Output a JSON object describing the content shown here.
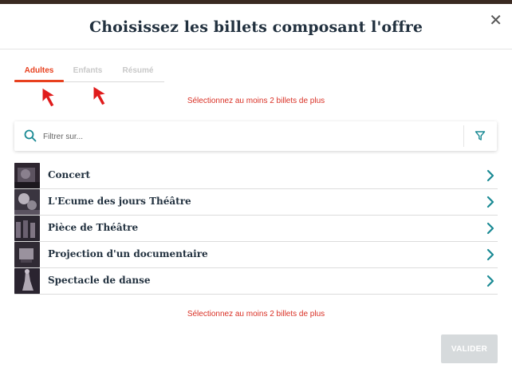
{
  "modal": {
    "title": "Choisissez les billets composant l'offre",
    "close_symbol": "✕"
  },
  "tabs": [
    {
      "label": "Adultes",
      "active": true
    },
    {
      "label": "Enfants",
      "active": false
    },
    {
      "label": "Résumé",
      "active": false
    }
  ],
  "warning_top": "Sélectionnez au moins 2 billets de plus",
  "warning_bottom": "Sélectionnez au moins 2 billets de plus",
  "search": {
    "placeholder": "Filtrer sur...",
    "icon": "search-icon",
    "filter_icon": "filter-icon"
  },
  "tickets": [
    {
      "label": "Concert"
    },
    {
      "label": "L'Ecume des jours Théâtre"
    },
    {
      "label": "Pièce de Théâtre"
    },
    {
      "label": "Projection d'un documentaire"
    },
    {
      "label": "Spectacle de danse"
    }
  ],
  "validate_label": "VALIDER",
  "colors": {
    "accent": "#e8411f",
    "teal": "#1a8a94",
    "warning": "#d93025",
    "title": "#22313f",
    "disabled_button": "#d6dadc"
  }
}
